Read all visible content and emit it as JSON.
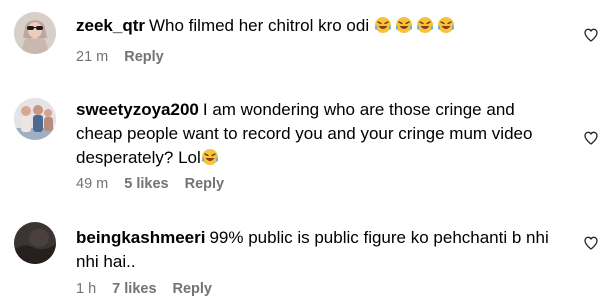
{
  "comments": [
    {
      "username": "zeek_qtr",
      "text": "Who filmed her chitrol kro odi",
      "emoji": [
        "laughing-crying-emoji",
        "laughing-crying-emoji",
        "laughing-crying-emoji",
        "laughing-crying-emoji"
      ],
      "time": "21 m",
      "likes": "",
      "reply_label": "Reply",
      "avatar": "avatar-woman-sunglasses"
    },
    {
      "username": "sweetyzoya200",
      "text_line1": "I am wondering who are those cringe and",
      "text_line2": "cheap people want to record you and your cringe mum video",
      "text_line3": "desperately? Lol",
      "emoji": [
        "laughing-crying-emoji"
      ],
      "time": "49 m",
      "likes": "5 likes",
      "reply_label": "Reply",
      "avatar": "avatar-group-photo"
    },
    {
      "username": "beingkashmeeri",
      "text_line1": "99% public is public figure ko pehchanti b nhi",
      "text_line2": "nhi hai..",
      "time": "1 h",
      "likes": "7 likes",
      "reply_label": "Reply",
      "avatar": "avatar-dark-photo"
    }
  ],
  "colors": {
    "meta": "#737373",
    "emoji_face": "#f7c33b",
    "emoji_mouth": "#8b3a1b",
    "tears": "#4fb3e8"
  }
}
